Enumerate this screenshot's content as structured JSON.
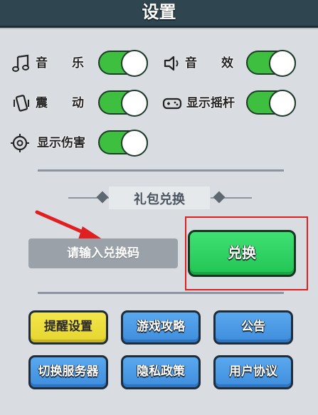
{
  "header": {
    "title": "设置"
  },
  "settings": [
    {
      "icon": "music-note-icon",
      "label": "音　　乐",
      "on": true
    },
    {
      "icon": "speaker-icon",
      "label": "音　　效",
      "on": true
    },
    {
      "icon": "vibration-icon",
      "label": "震　　动",
      "on": true
    },
    {
      "icon": "gamepad-icon",
      "label": "显示摇杆",
      "on": true
    },
    {
      "icon": "target-icon",
      "label": "显示伤害",
      "on": true
    }
  ],
  "gift": {
    "title": "礼包兑换",
    "input_placeholder": "请输入兑换码",
    "redeem_label": "兑换"
  },
  "buttons": [
    {
      "label": "提醒设置"
    },
    {
      "label": "游戏攻略"
    },
    {
      "label": "公告"
    },
    {
      "label": "切换服务器"
    },
    {
      "label": "隐私政策"
    },
    {
      "label": "用户协议"
    }
  ],
  "colors": {
    "toggle_on": "#3fbf3f",
    "redeem_green": "#22c454",
    "button_blue": "#3e8ddd",
    "button_yellow": "#e6d530",
    "highlight_red": "#e02020"
  }
}
